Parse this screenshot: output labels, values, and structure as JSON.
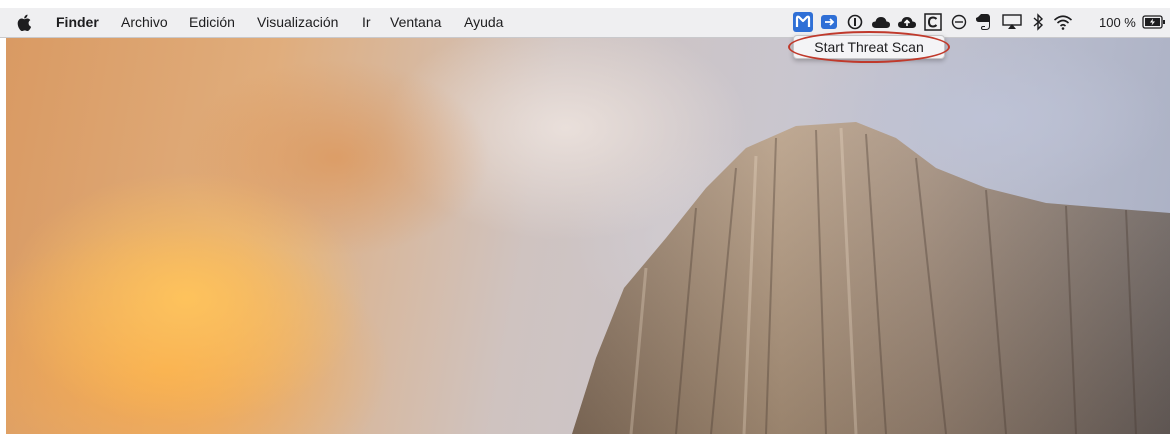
{
  "menubar": {
    "apple_icon": "apple-logo-icon",
    "app_name": "Finder",
    "menus": [
      "Archivo",
      "Edición",
      "Visualización",
      "Ir",
      "Ventana",
      "Ayuda"
    ],
    "status_icons": [
      "malwarebytes-icon",
      "vpn-icon",
      "onepassword-icon",
      "cloud-icon",
      "cloud-upload-icon",
      "c-app-icon",
      "do-not-disturb-icon",
      "evernote-icon",
      "airplay-icon",
      "bluetooth-icon",
      "wifi-icon"
    ],
    "battery_percent": "100 %",
    "battery_icon": "battery-charging-icon"
  },
  "tooltip": {
    "label": "Start Threat Scan"
  },
  "colors": {
    "menubar_bg": "#eeeef0",
    "highlight": "#2f6fd6",
    "annotation": "#c0392b"
  }
}
